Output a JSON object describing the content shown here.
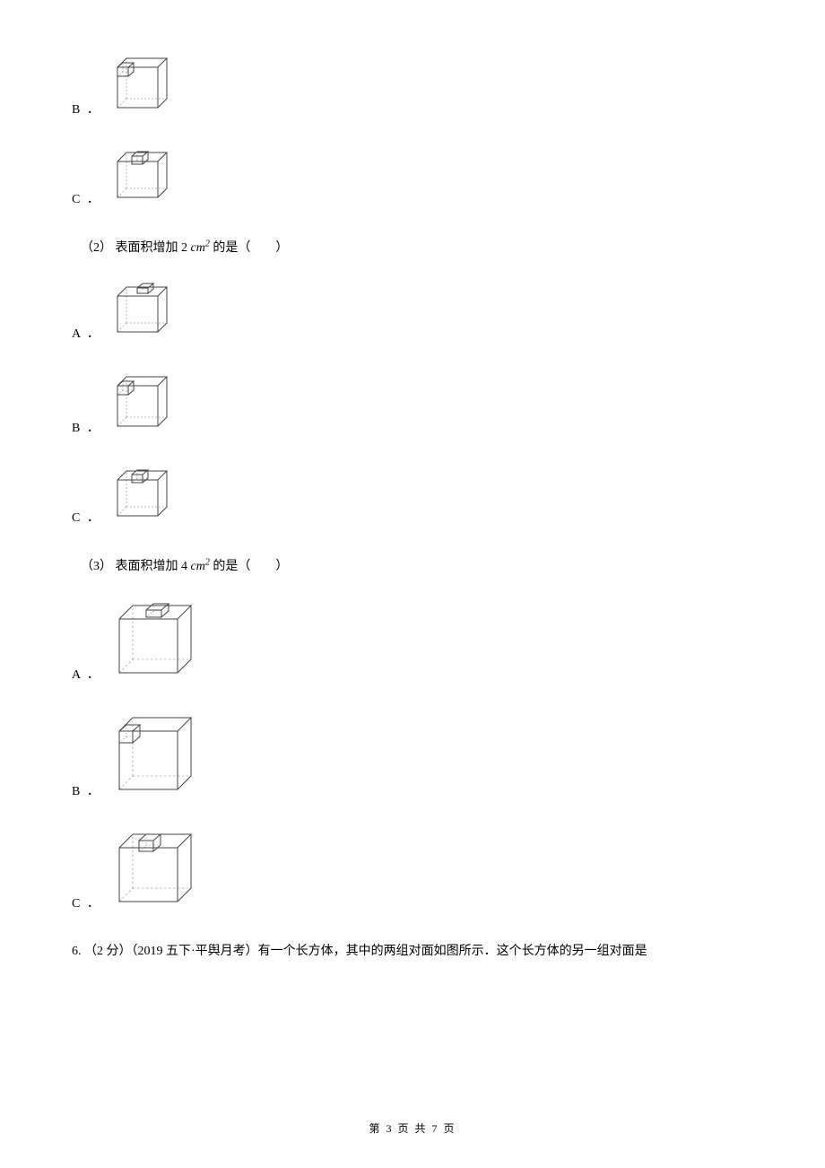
{
  "options_top": {
    "b_label": "B ．",
    "c_label": "C ．"
  },
  "q2": {
    "prefix": "（2） 表面积增加 2 ",
    "unit_base": "cm",
    "unit_exp": "2",
    "suffix": " 的是（　　）",
    "a_label": "A ．",
    "b_label": "B ．",
    "c_label": "C ．"
  },
  "q3": {
    "prefix": "（3） 表面积增加 4 ",
    "unit_base": "cm",
    "unit_exp": "2",
    "suffix": " 的是（　　）",
    "a_label": "A ．",
    "b_label": "B ．",
    "c_label": "C ．"
  },
  "q6": {
    "text": "6. （2 分）（2019 五下·平舆月考）有一个长方体，其中的两组对面如图所示．这个长方体的另一组对面是"
  },
  "footer": {
    "text": "第 3 页 共 7 页"
  }
}
